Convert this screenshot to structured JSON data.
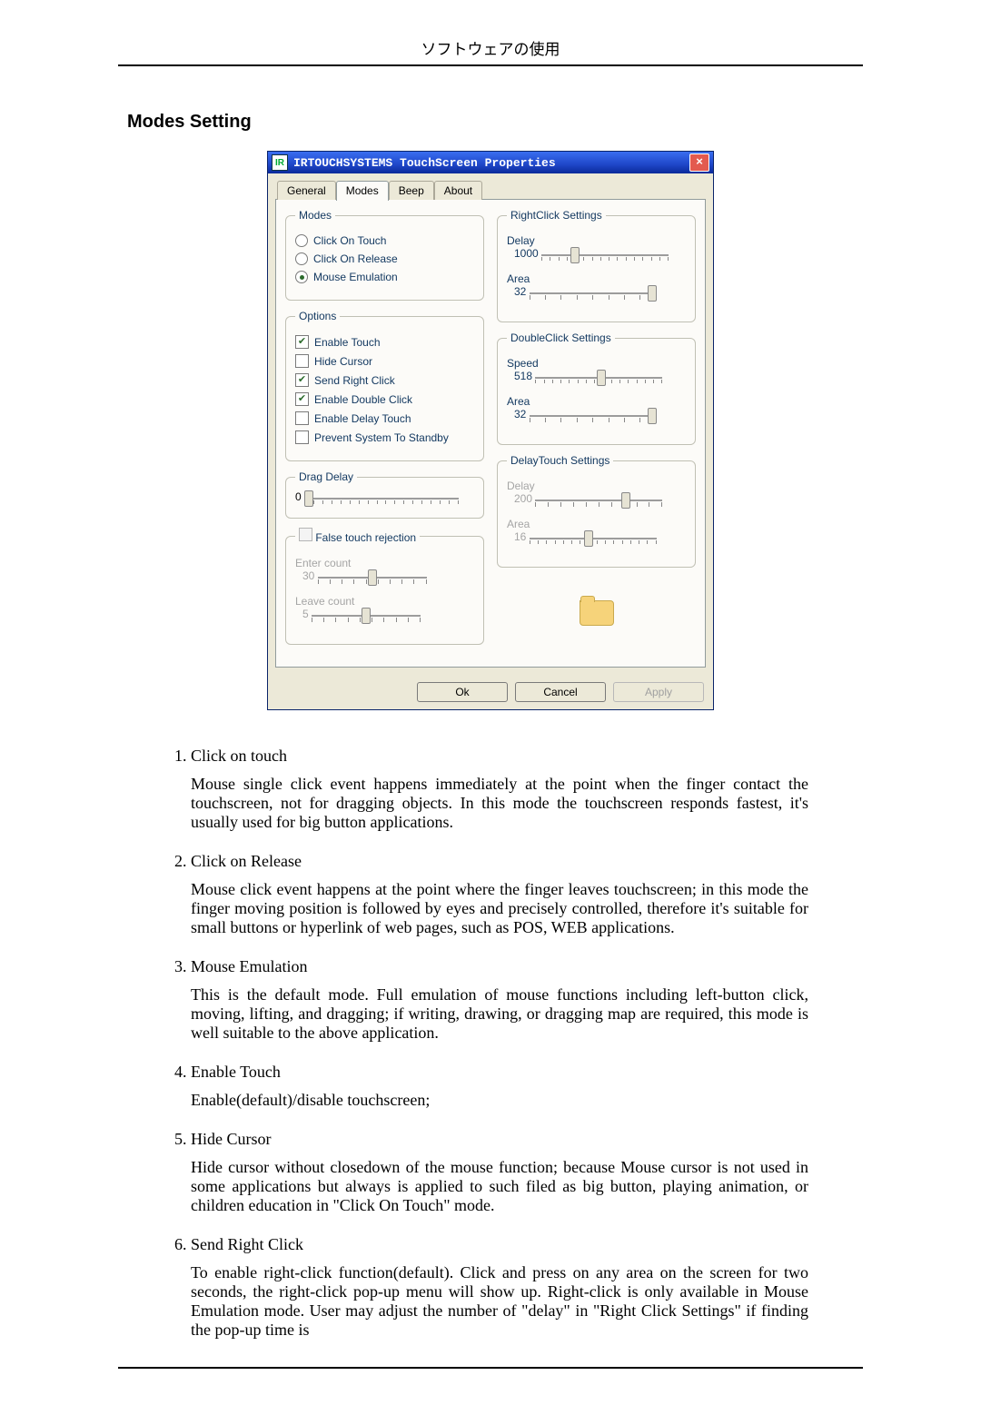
{
  "page_header": "ソフトウェアの使用",
  "section_title": "Modes Setting",
  "dialog": {
    "title": "IRTOUCHSYSTEMS TouchScreen Properties",
    "icon_text": "IR",
    "tabs": [
      "General",
      "Modes",
      "Beep",
      "About"
    ],
    "active_tab": 1,
    "modes": {
      "legend": "Modes",
      "click_on_touch": "Click On Touch",
      "click_on_release": "Click On Release",
      "mouse_emulation": "Mouse Emulation"
    },
    "options": {
      "legend": "Options",
      "enable_touch": "Enable Touch",
      "hide_cursor": "Hide Cursor",
      "send_right_click": "Send Right Click",
      "enable_double_click": "Enable Double Click",
      "enable_delay_touch": "Enable Delay Touch",
      "prevent_standby": "Prevent System To Standby"
    },
    "drag_delay": {
      "legend": "Drag Delay",
      "value": "0"
    },
    "false_touch": {
      "legend": "False touch rejection",
      "enter_label": "Enter count",
      "enter_value": "30",
      "leave_label": "Leave count",
      "leave_value": "5"
    },
    "rightclick": {
      "legend": "RightClick Settings",
      "delay_label": "Delay",
      "delay_value": "1000",
      "area_label": "Area",
      "area_value": "32"
    },
    "doubleclick": {
      "legend": "DoubleClick Settings",
      "speed_label": "Speed",
      "speed_value": "518",
      "area_label": "Area",
      "area_value": "32"
    },
    "delaytouch": {
      "legend": "DelayTouch Settings",
      "delay_label": "Delay",
      "delay_value": "200",
      "area_label": "Area",
      "area_value": "16"
    },
    "buttons": {
      "ok": "Ok",
      "cancel": "Cancel",
      "apply": "Apply"
    }
  },
  "items": [
    {
      "title": "Click on touch",
      "body": "Mouse single click event happens immediately at the point when the finger contact the touchscreen, not for dragging objects. In this mode the touchscreen responds fastest, it's usually used for big button applications."
    },
    {
      "title": "Click on Release",
      "body": "Mouse click event happens at the point where the finger leaves touchscreen; in this mode the finger moving position is followed by eyes and precisely controlled, therefore it's suitable for small buttons or hyperlink of web pages, such as POS, WEB applications."
    },
    {
      "title": "Mouse Emulation",
      "body": "This is the default mode. Full emulation of mouse functions including left-button click, moving, lifting, and dragging; if writing, drawing, or dragging map are required, this mode is well suitable to the above application."
    },
    {
      "title": "Enable Touch",
      "body": "Enable(default)/disable touchscreen;"
    },
    {
      "title": "Hide Cursor",
      "body": "Hide cursor without closedown of the mouse function; because Mouse cursor is not used in some applications but always is applied to such filed as big button, playing animation, or children education in \"Click On Touch\" mode."
    },
    {
      "title": "Send Right Click",
      "body": "To enable right-click function(default). Click and press on any area on the screen for two seconds, the right-click pop-up menu will show up. Right-click is only available in Mouse Emulation mode. User may adjust the number of \"delay\" in \"Right Click Settings\" if finding the pop-up time is"
    }
  ]
}
